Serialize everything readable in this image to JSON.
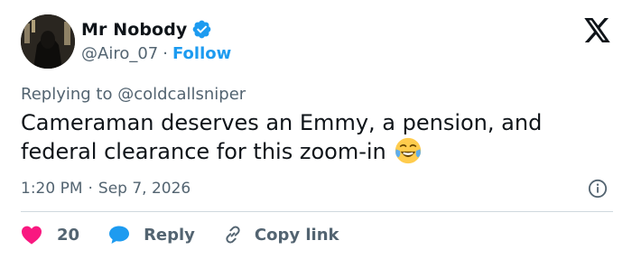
{
  "author": {
    "display_name": "Mr Nobody",
    "handle": "@Airo_07",
    "separator": "·",
    "follow_label": "Follow",
    "verified": true
  },
  "replying": {
    "prefix": "Replying to",
    "target": "@coldcallsniper"
  },
  "tweet": {
    "text": "Cameraman deserves an Emmy, a pension, and federal clearance for this zoom-in",
    "emoji": "face-with-tears-of-joy"
  },
  "meta": {
    "time": "1:20 PM",
    "separator": "·",
    "date": "Sep 7, 2026"
  },
  "actions": {
    "like_count": "20",
    "reply_label": "Reply",
    "copy_link_label": "Copy link"
  },
  "colors": {
    "accent": "#1d9bf0",
    "like": "#f91880",
    "secondary_text": "#536471",
    "primary_text": "#0f1419",
    "divider": "#cfd9de"
  },
  "icons": [
    "verified-badge-icon",
    "x-logo-icon",
    "info-icon",
    "heart-icon",
    "reply-bubble-icon",
    "link-icon"
  ]
}
